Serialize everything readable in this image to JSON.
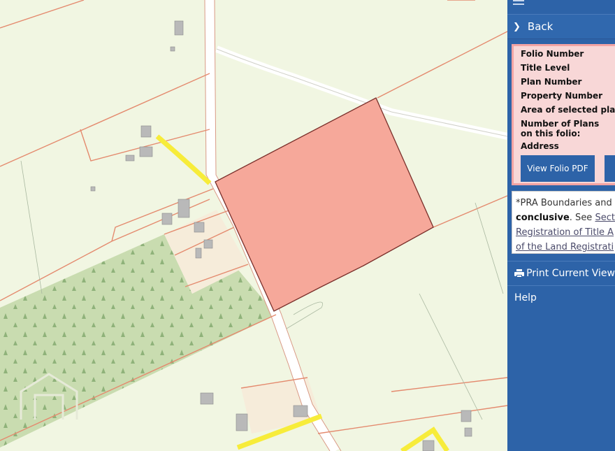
{
  "map": {
    "watermark_icon": "house-logo-watermark",
    "colors": {
      "background": "#f1f6e2",
      "parcel_lines": "#e48a6e",
      "selected_parcel_fill": "#f6a89a",
      "selected_parcel_border": "#7a2f2a",
      "forest_fill": "#c9dcb0",
      "highlight_road": "#f7ec3a",
      "road_fill": "#ffffff",
      "building": "#b9b9b9"
    }
  },
  "sidebar": {
    "menu_icon": "hamburger-icon",
    "back_label": "Back",
    "folio_fields": [
      "Folio Number",
      "Title Level",
      "Plan Number",
      "Property Number",
      "Area of selected plans",
      "Number of Plans on this folio:",
      "Address"
    ],
    "view_pdf_label": "View Folio PDF",
    "note": {
      "line1": "*PRA Boundaries and Pl",
      "bold": "conclusive",
      "see": ". See ",
      "link1": "Sectio",
      "link2": "Registration of Title A",
      "link3": "of the Land Registrati"
    },
    "print_label": "Print Current View",
    "help_label": "Help",
    "colors": {
      "panel_bg": "#2d63a8",
      "folio_bg": "#f8d7d7",
      "folio_border": "#f2a3a3"
    }
  }
}
